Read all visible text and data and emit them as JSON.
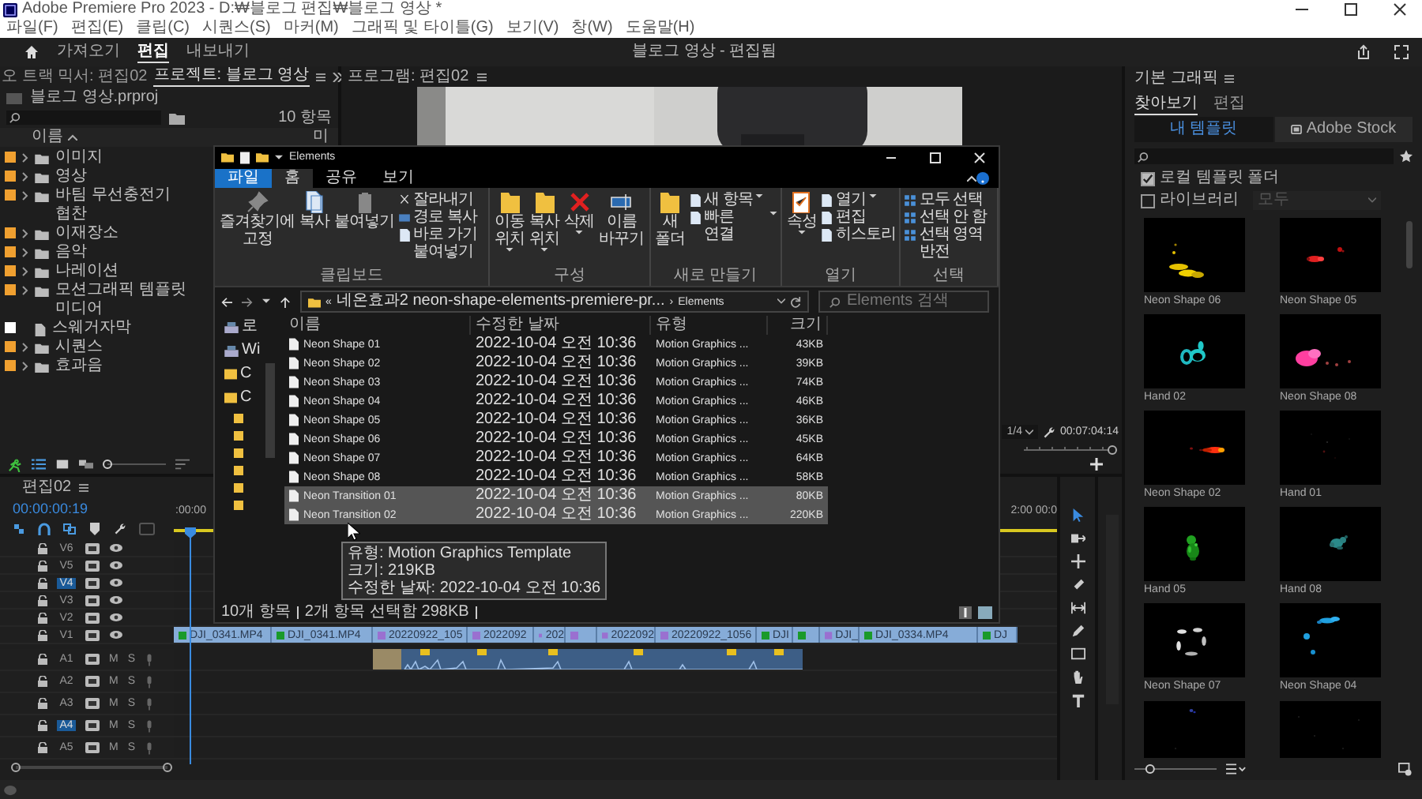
{
  "window": {
    "title": "Adobe Premiere Pro 2023 - D:₩블로그 편집₩블로그 영상 *"
  },
  "menu": [
    "파일(F)",
    "편집(E)",
    "클립(C)",
    "시퀀스(S)",
    "마커(M)",
    "그래픽 및 타이틀(G)",
    "보기(V)",
    "창(W)",
    "도움말(H)"
  ],
  "workspace": {
    "tabs": [
      {
        "label": "가져오기",
        "selected": false
      },
      {
        "label": "편집",
        "selected": true
      },
      {
        "label": "내보내기",
        "selected": false
      }
    ],
    "title": "블로그 영상 - 편집됨"
  },
  "project_panel": {
    "tabs": [
      {
        "label": "오 트랙 믹서: 편집02",
        "selected": false
      },
      {
        "label": "프로젝트: 블로그 영상",
        "selected": true
      }
    ],
    "file": "블로그 영상.prproj",
    "count": "10 항목",
    "columns": [
      "이름",
      "미"
    ],
    "items": [
      {
        "name": "이미지",
        "kind": "folder",
        "color": "#f0a030"
      },
      {
        "name": "영상",
        "kind": "folder",
        "color": "#f0a030"
      },
      {
        "name": "바팀 무선충전기 협찬",
        "kind": "folder",
        "color": "#f0a030"
      },
      {
        "name": "이재장소",
        "kind": "folder",
        "color": "#f0a030"
      },
      {
        "name": "음악",
        "kind": "folder",
        "color": "#f0a030"
      },
      {
        "name": "나레이션",
        "kind": "folder",
        "color": "#f0a030"
      },
      {
        "name": "모션그래픽 템플릿 미디어",
        "kind": "folder",
        "color": "#f0a030"
      },
      {
        "name": "스웨거자막",
        "kind": "file",
        "color": "#ffffff"
      },
      {
        "name": "시퀀스",
        "kind": "folder",
        "color": "#f0a030"
      },
      {
        "name": "효과음",
        "kind": "folder",
        "color": "#f0a030"
      }
    ],
    "zoom_slider": {
      "level": 0
    }
  },
  "program_monitor": {
    "title": "프로그램: 편집02",
    "zoom": "1/4",
    "timecode": "00:07:04:14"
  },
  "explorer": {
    "title": "Elements",
    "ribbon_tabs": [
      {
        "label": "파일",
        "kind": "file",
        "selected": false
      },
      {
        "label": "홈",
        "kind": "tab",
        "selected": true
      },
      {
        "label": "공유",
        "kind": "tab",
        "selected": false
      },
      {
        "label": "보기",
        "kind": "tab",
        "selected": false
      }
    ],
    "ribbon_groups": [
      {
        "label": "클립보드",
        "buttons": [
          {
            "label": "즐겨찾기에 고정",
            "kind": "pin",
            "dropdown": false
          },
          {
            "label": "복사",
            "kind": "copy",
            "dropdown": false
          },
          {
            "label": "붙여넣기",
            "kind": "paste",
            "dropdown": false
          }
        ],
        "small_buttons": [
          {
            "label": "잘라내기",
            "kind": "cut",
            "dropdown": false
          },
          {
            "label": "경로 복사",
            "kind": "path",
            "dropdown": false
          },
          {
            "label": "바로 가기 붙여넣기",
            "kind": "shortcut",
            "dropdown": false
          }
        ]
      },
      {
        "label": "구성",
        "buttons": [
          {
            "label": "이동 위치",
            "kind": "move",
            "dropdown": true
          },
          {
            "label": "복사 위치",
            "kind": "copyto",
            "dropdown": true
          },
          {
            "label": "삭제",
            "kind": "delete",
            "dropdown": true
          },
          {
            "label": "이름 바꾸기",
            "kind": "rename",
            "dropdown": false
          }
        ]
      },
      {
        "label": "새로 만들기",
        "buttons": [
          {
            "label": "새 폴더",
            "kind": "newfolder",
            "dropdown": false
          }
        ],
        "small_buttons": [
          {
            "label": "새 항목",
            "kind": "newitem",
            "dropdown": true
          },
          {
            "label": "빠른 연결",
            "kind": "easyaccess",
            "dropdown": true
          }
        ]
      },
      {
        "label": "열기",
        "buttons": [
          {
            "label": "속성",
            "kind": "properties",
            "dropdown": true
          }
        ],
        "small_buttons": [
          {
            "label": "열기",
            "kind": "open",
            "dropdown": true
          },
          {
            "label": "편집",
            "kind": "edit",
            "dropdown": false
          },
          {
            "label": "히스토리",
            "kind": "history",
            "dropdown": false
          }
        ]
      },
      {
        "label": "선택",
        "small_buttons": [
          {
            "label": "모두 선택",
            "kind": "selectall",
            "dropdown": false
          },
          {
            "label": "선택 안 함",
            "kind": "selectnone",
            "dropdown": false
          },
          {
            "label": "선택 영역 반전",
            "kind": "invert",
            "dropdown": false
          }
        ]
      }
    ],
    "address": {
      "prefix": "«",
      "path": "네온효과2 neon-shape-elements-premiere-pr...",
      "separator": "›",
      "current": "Elements"
    },
    "search": {
      "placeholder": "Elements 검색"
    },
    "nav_items": [
      {
        "label": "로",
        "kind": "drive"
      },
      {
        "label": "Wi",
        "kind": "drive"
      },
      {
        "label": "C",
        "kind": "folder"
      },
      {
        "label": "C",
        "kind": "folder"
      }
    ],
    "columns": [
      "이름",
      "수정한 날짜",
      "유형",
      "크기"
    ],
    "files": [
      {
        "name": "Neon Shape 01",
        "date": "2022-10-04 오전 10:36",
        "type": "Motion Graphics ...",
        "size": "43KB",
        "selected": false
      },
      {
        "name": "Neon Shape 02",
        "date": "2022-10-04 오전 10:36",
        "type": "Motion Graphics ...",
        "size": "39KB",
        "selected": false
      },
      {
        "name": "Neon Shape 03",
        "date": "2022-10-04 오전 10:36",
        "type": "Motion Graphics ...",
        "size": "74KB",
        "selected": false
      },
      {
        "name": "Neon Shape 04",
        "date": "2022-10-04 오전 10:36",
        "type": "Motion Graphics ...",
        "size": "46KB",
        "selected": false
      },
      {
        "name": "Neon Shape 05",
        "date": "2022-10-04 오전 10:36",
        "type": "Motion Graphics ...",
        "size": "36KB",
        "selected": false
      },
      {
        "name": "Neon Shape 06",
        "date": "2022-10-04 오전 10:36",
        "type": "Motion Graphics ...",
        "size": "45KB",
        "selected": false
      },
      {
        "name": "Neon Shape 07",
        "date": "2022-10-04 오전 10:36",
        "type": "Motion Graphics ...",
        "size": "64KB",
        "selected": false
      },
      {
        "name": "Neon Shape 08",
        "date": "2022-10-04 오전 10:36",
        "type": "Motion Graphics ...",
        "size": "58KB",
        "selected": false
      },
      {
        "name": "Neon Transition 01",
        "date": "2022-10-04 오전 10:36",
        "type": "Motion Graphics ...",
        "size": "80KB",
        "selected": true
      },
      {
        "name": "Neon Transition 02",
        "date": "2022-10-04 오전 10:36",
        "type": "Motion Graphics ...",
        "size": "220KB",
        "selected": true
      }
    ],
    "tooltip": [
      "유형: Motion Graphics Template",
      "크기: 219KB",
      "수정한 날짜: 2022-10-04 오전 10:36"
    ],
    "status": [
      "10개 항목",
      "2개 항목 선택함 298KB"
    ]
  },
  "timeline": {
    "title": "편집02",
    "timecode": "00:00:00:19",
    "ruler": [
      ":00:00",
      "2:00",
      "00:0"
    ],
    "video_tracks": [
      {
        "name": "V6",
        "selected": false
      },
      {
        "name": "V5",
        "selected": false
      },
      {
        "name": "V4",
        "selected": true
      },
      {
        "name": "V3",
        "selected": false
      },
      {
        "name": "V2",
        "selected": false
      },
      {
        "name": "V1",
        "selected": false
      }
    ],
    "audio_tracks": [
      {
        "name": "A1",
        "selected": false,
        "mute": "M",
        "solo": "S"
      },
      {
        "name": "A2",
        "selected": false,
        "mute": "M",
        "solo": "S"
      },
      {
        "name": "A3",
        "selected": false,
        "mute": "M",
        "solo": "S"
      },
      {
        "name": "A4",
        "selected": true,
        "mute": "M",
        "solo": "S"
      },
      {
        "name": "A5",
        "selected": false,
        "mute": "M",
        "solo": "S"
      }
    ],
    "clips": [
      {
        "label": "DJI_0341.MP4",
        "kind": "video"
      },
      {
        "label": "DJI_0341.MP4",
        "kind": "video"
      },
      {
        "label": "20220922_105",
        "kind": "graphic"
      },
      {
        "label": "2022092",
        "kind": "graphic"
      },
      {
        "label": "202",
        "kind": "graphic"
      },
      {
        "kind": "graphic"
      },
      {
        "label": "2022092",
        "kind": "graphic"
      },
      {
        "label": "20220922_1056",
        "kind": "graphic"
      },
      {
        "label": "DJI",
        "kind": "video"
      },
      {
        "kind": "video"
      },
      {
        "label": "DJI_",
        "kind": "graphic"
      },
      {
        "label": "DJI_0334.MP4",
        "kind": "video"
      },
      {
        "label": "DJ",
        "kind": "video"
      }
    ]
  },
  "essential_graphics": {
    "title": "기본 그래픽",
    "tabs": [
      {
        "label": "찾아보기",
        "selected": true
      },
      {
        "label": "편집",
        "selected": false
      }
    ],
    "sources": [
      {
        "label": "내 템플릿",
        "selected": true
      },
      {
        "label": "Adobe Stock",
        "selected": false
      }
    ],
    "filters": [
      {
        "label": "로컬 템플릿 폴더",
        "checked": true
      },
      {
        "label": "라이브러리",
        "checked": false
      }
    ],
    "library_dropdown": {
      "value": "모두",
      "disabled": true
    },
    "templates": [
      {
        "label": "Neon Shape 06",
        "kind": "template"
      },
      {
        "label": "Neon Shape 05",
        "kind": "template"
      },
      {
        "label": "Hand 02",
        "kind": "template"
      },
      {
        "label": "Neon Shape 08",
        "kind": "template"
      },
      {
        "label": "Neon Shape 02",
        "kind": "template"
      },
      {
        "label": "Hand 01",
        "kind": "template"
      },
      {
        "label": "Hand 05",
        "kind": "template"
      },
      {
        "label": "Hand 08",
        "kind": "template"
      },
      {
        "label": "Neon Shape 07",
        "kind": "template"
      },
      {
        "label": "Neon Shape 04",
        "kind": "template"
      },
      {
        "kind": "picture"
      },
      {
        "kind": "picture"
      }
    ],
    "size_slider": {
      "level": 0.15
    }
  }
}
